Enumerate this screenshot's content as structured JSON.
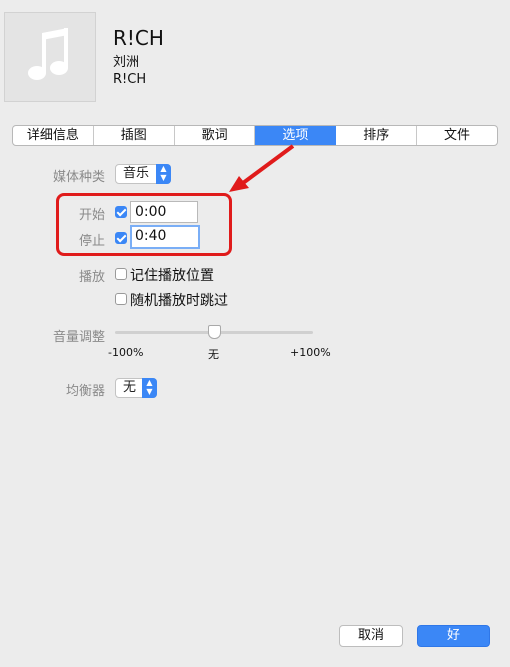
{
  "track": {
    "title": "R!CH",
    "artist": "刘洲",
    "album": "R!CH"
  },
  "tabs": [
    "详细信息",
    "插图",
    "歌词",
    "选项",
    "排序",
    "文件"
  ],
  "active_tab_index": 3,
  "options": {
    "media_kind": {
      "label": "媒体种类",
      "value": "音乐"
    },
    "start": {
      "label": "开始",
      "checked": true,
      "value": "0:00"
    },
    "stop": {
      "label": "停止",
      "checked": true,
      "value": "0:40"
    },
    "playback": {
      "label": "播放",
      "remember_position": "记住播放位置",
      "skip_when_shuffling": "随机播放时跳过"
    },
    "volume": {
      "label": "音量调整",
      "min_label": "-100%",
      "mid_label": "无",
      "max_label": "+100%",
      "value_percent": 0
    },
    "equalizer": {
      "label": "均衡器",
      "value": "无"
    }
  },
  "buttons": {
    "cancel": "取消",
    "ok": "好"
  },
  "colors": {
    "accent": "#3b87f6",
    "annotation": "#e01b1b"
  }
}
